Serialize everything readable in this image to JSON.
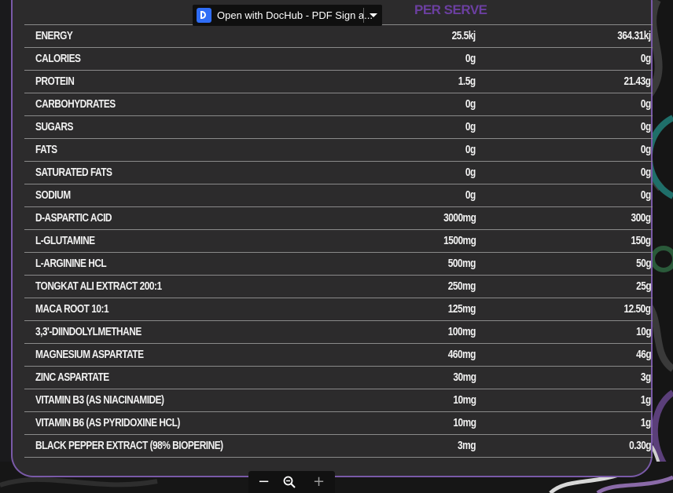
{
  "column_header": "PER SERVE",
  "rows": [
    {
      "name": "ENERGY",
      "per_serve": "25.5kj",
      "per_100g": "364.31kj"
    },
    {
      "name": "CALORIES",
      "per_serve": "0g",
      "per_100g": "0g"
    },
    {
      "name": "PROTEIN",
      "per_serve": "1.5g",
      "per_100g": "21.43g"
    },
    {
      "name": "CARBOHYDRATES",
      "per_serve": "0g",
      "per_100g": "0g"
    },
    {
      "name": "SUGARS",
      "per_serve": "0g",
      "per_100g": "0g"
    },
    {
      "name": "FATS",
      "per_serve": "0g",
      "per_100g": "0g"
    },
    {
      "name": "SATURATED FATS",
      "per_serve": "0g",
      "per_100g": "0g"
    },
    {
      "name": "SODIUM",
      "per_serve": "0g",
      "per_100g": "0g"
    },
    {
      "name": "D-ASPARTIC ACID",
      "per_serve": "3000mg",
      "per_100g": "300g"
    },
    {
      "name": "L-GLUTAMINE",
      "per_serve": "1500mg",
      "per_100g": "150g"
    },
    {
      "name": "L-ARGININE HCL",
      "per_serve": "500mg",
      "per_100g": "50g"
    },
    {
      "name": "TONGKAT ALI EXTRACT 200:1",
      "per_serve": "250mg",
      "per_100g": "25g"
    },
    {
      "name": "MACA ROOT 10:1",
      "per_serve": "125mg",
      "per_100g": "12.50g"
    },
    {
      "name": "3,3'-DIINDOLYLMETHANE",
      "per_serve": "100mg",
      "per_100g": "10g"
    },
    {
      "name": "MAGNESIUM ASPARTATE",
      "per_serve": "460mg",
      "per_100g": "46g"
    },
    {
      "name": "ZINC ASPARTATE",
      "per_serve": "30mg",
      "per_100g": "3g"
    },
    {
      "name": "VITAMIN B3 (AS NIACINAMIDE)",
      "per_serve": "10mg",
      "per_100g": "1g"
    },
    {
      "name": "VITAMIN B6 (AS PYRIDOXINE HCL)",
      "per_serve": "10mg",
      "per_100g": "1g"
    },
    {
      "name": "BLACK PEPPER EXTRACT (98% BIOPERINE)",
      "per_serve": "3mg",
      "per_100g": "0.30g"
    }
  ],
  "dochub": {
    "label": "Open with DocHub - PDF Sign a...",
    "icon": "dochub-logo-icon",
    "menu_icon": "chevron-down-icon"
  },
  "zoombar": {
    "zoom_out_icon": "minus-icon",
    "zoom_icon": "magnifier-icon",
    "zoom_in_icon": "plus-icon"
  },
  "colors": {
    "panel": "#2c2b2c",
    "border": "#7a5aa8",
    "header": "#6b3fa0",
    "text": "#f2f2f2",
    "dochub_accent": "#2f6df6"
  }
}
